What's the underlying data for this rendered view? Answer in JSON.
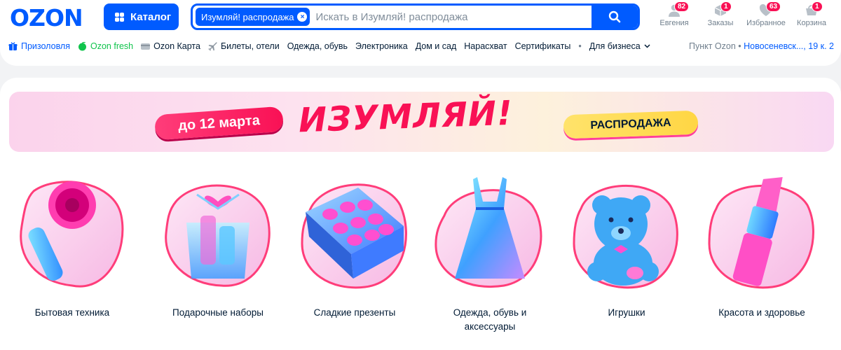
{
  "header": {
    "logo": "OZON",
    "catalog_label": "Каталог",
    "search": {
      "chip_label": "Изумляй! распродажа",
      "chip_close": "×",
      "placeholder": "Искать в Изумляй! распродажа"
    },
    "actions": [
      {
        "label": "Евгения",
        "badge": "82",
        "icon": "user-icon"
      },
      {
        "label": "Заказы",
        "badge": "1",
        "icon": "box-icon"
      },
      {
        "label": "Избранное",
        "badge": "63",
        "icon": "heart-icon"
      },
      {
        "label": "Корзина",
        "badge": "1",
        "icon": "cart-icon"
      }
    ]
  },
  "nav": {
    "items": [
      {
        "label": "Призоловля",
        "icon": "gift-icon",
        "style": "blue"
      },
      {
        "label": "Ozon fresh",
        "icon": "leaf-icon",
        "style": "green"
      },
      {
        "label": "Ozon Карта",
        "icon": "card-icon",
        "style": "gray"
      },
      {
        "label": "Билеты, отели",
        "icon": "plane-icon",
        "style": "gray"
      },
      {
        "label": "Одежда, обувь"
      },
      {
        "label": "Электроника"
      },
      {
        "label": "Дом и сад"
      },
      {
        "label": "Нарасхват"
      },
      {
        "label": "Сертификаты"
      },
      {
        "label": "Для бизнеса"
      }
    ],
    "separator": "•",
    "pickup_label": "Пункт Ozon",
    "pickup_address": "Новосеневск...",
    "pickup_suffix": ", 19 к. 2"
  },
  "banner": {
    "date_pill": "до 12 марта",
    "title": "ИЗУМЛЯЙ!",
    "sale_pill": "РАСПРОДАЖА"
  },
  "categories": [
    {
      "label": "Бытовая техника",
      "icon": "hairdryer-icon"
    },
    {
      "label": "Подарочные наборы",
      "icon": "gift-set-icon"
    },
    {
      "label": "Сладкие презенты",
      "icon": "candy-box-icon"
    },
    {
      "label": "Одежда, обувь и аксессуары",
      "icon": "dress-icon"
    },
    {
      "label": "Игрушки",
      "icon": "teddy-bear-icon"
    },
    {
      "label": "Красота и здоровье",
      "icon": "lipstick-icon"
    }
  ],
  "colors": {
    "brand": "#005bff",
    "accent": "#f91155",
    "fresh": "#10c44c"
  }
}
